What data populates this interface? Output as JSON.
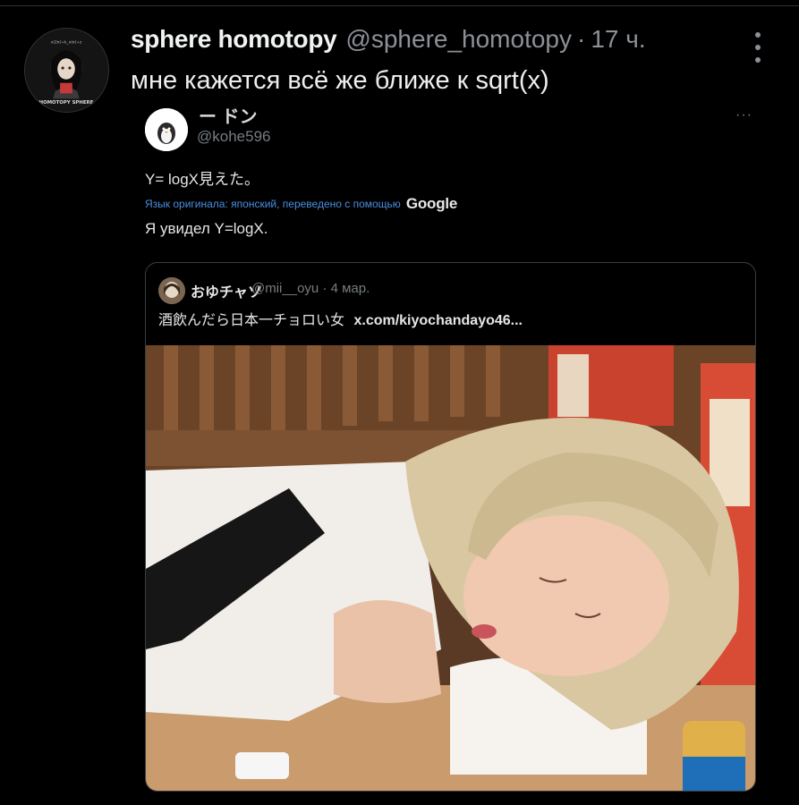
{
  "tweet": {
    "author_name": "sphere homotopy",
    "handle": "@sphere_homotopy",
    "separator": "·",
    "time": "17 ч.",
    "text": "мне кажется всё же ближе к sqrt(x)",
    "avatar_label": "HOMOTOPY SPHERE"
  },
  "quoted_screenshot": {
    "name": "ー ドン",
    "handle": "@kohe596",
    "more": "···",
    "text": "Y= logX見えた。",
    "translation_note": "Язык оригинала: японский, переведено с помощью",
    "translation_provider": "Google",
    "translated_text": "Я увидел Y=logX.",
    "quote": {
      "name": "おゆチャソ",
      "handle": "@mii__oyu",
      "separator": "·",
      "date": "4 мар.",
      "text": "酒飲んだら日本一チョロい女",
      "link": "x.com/kiyochandayo46..."
    }
  },
  "colors": {
    "background": "#000000",
    "secondary_text": "#8b9197",
    "translation_link": "#4a8ee0",
    "border": "#3a3d40"
  },
  "icons": [
    "more-vertical-icon",
    "more-horizontal-icon"
  ]
}
